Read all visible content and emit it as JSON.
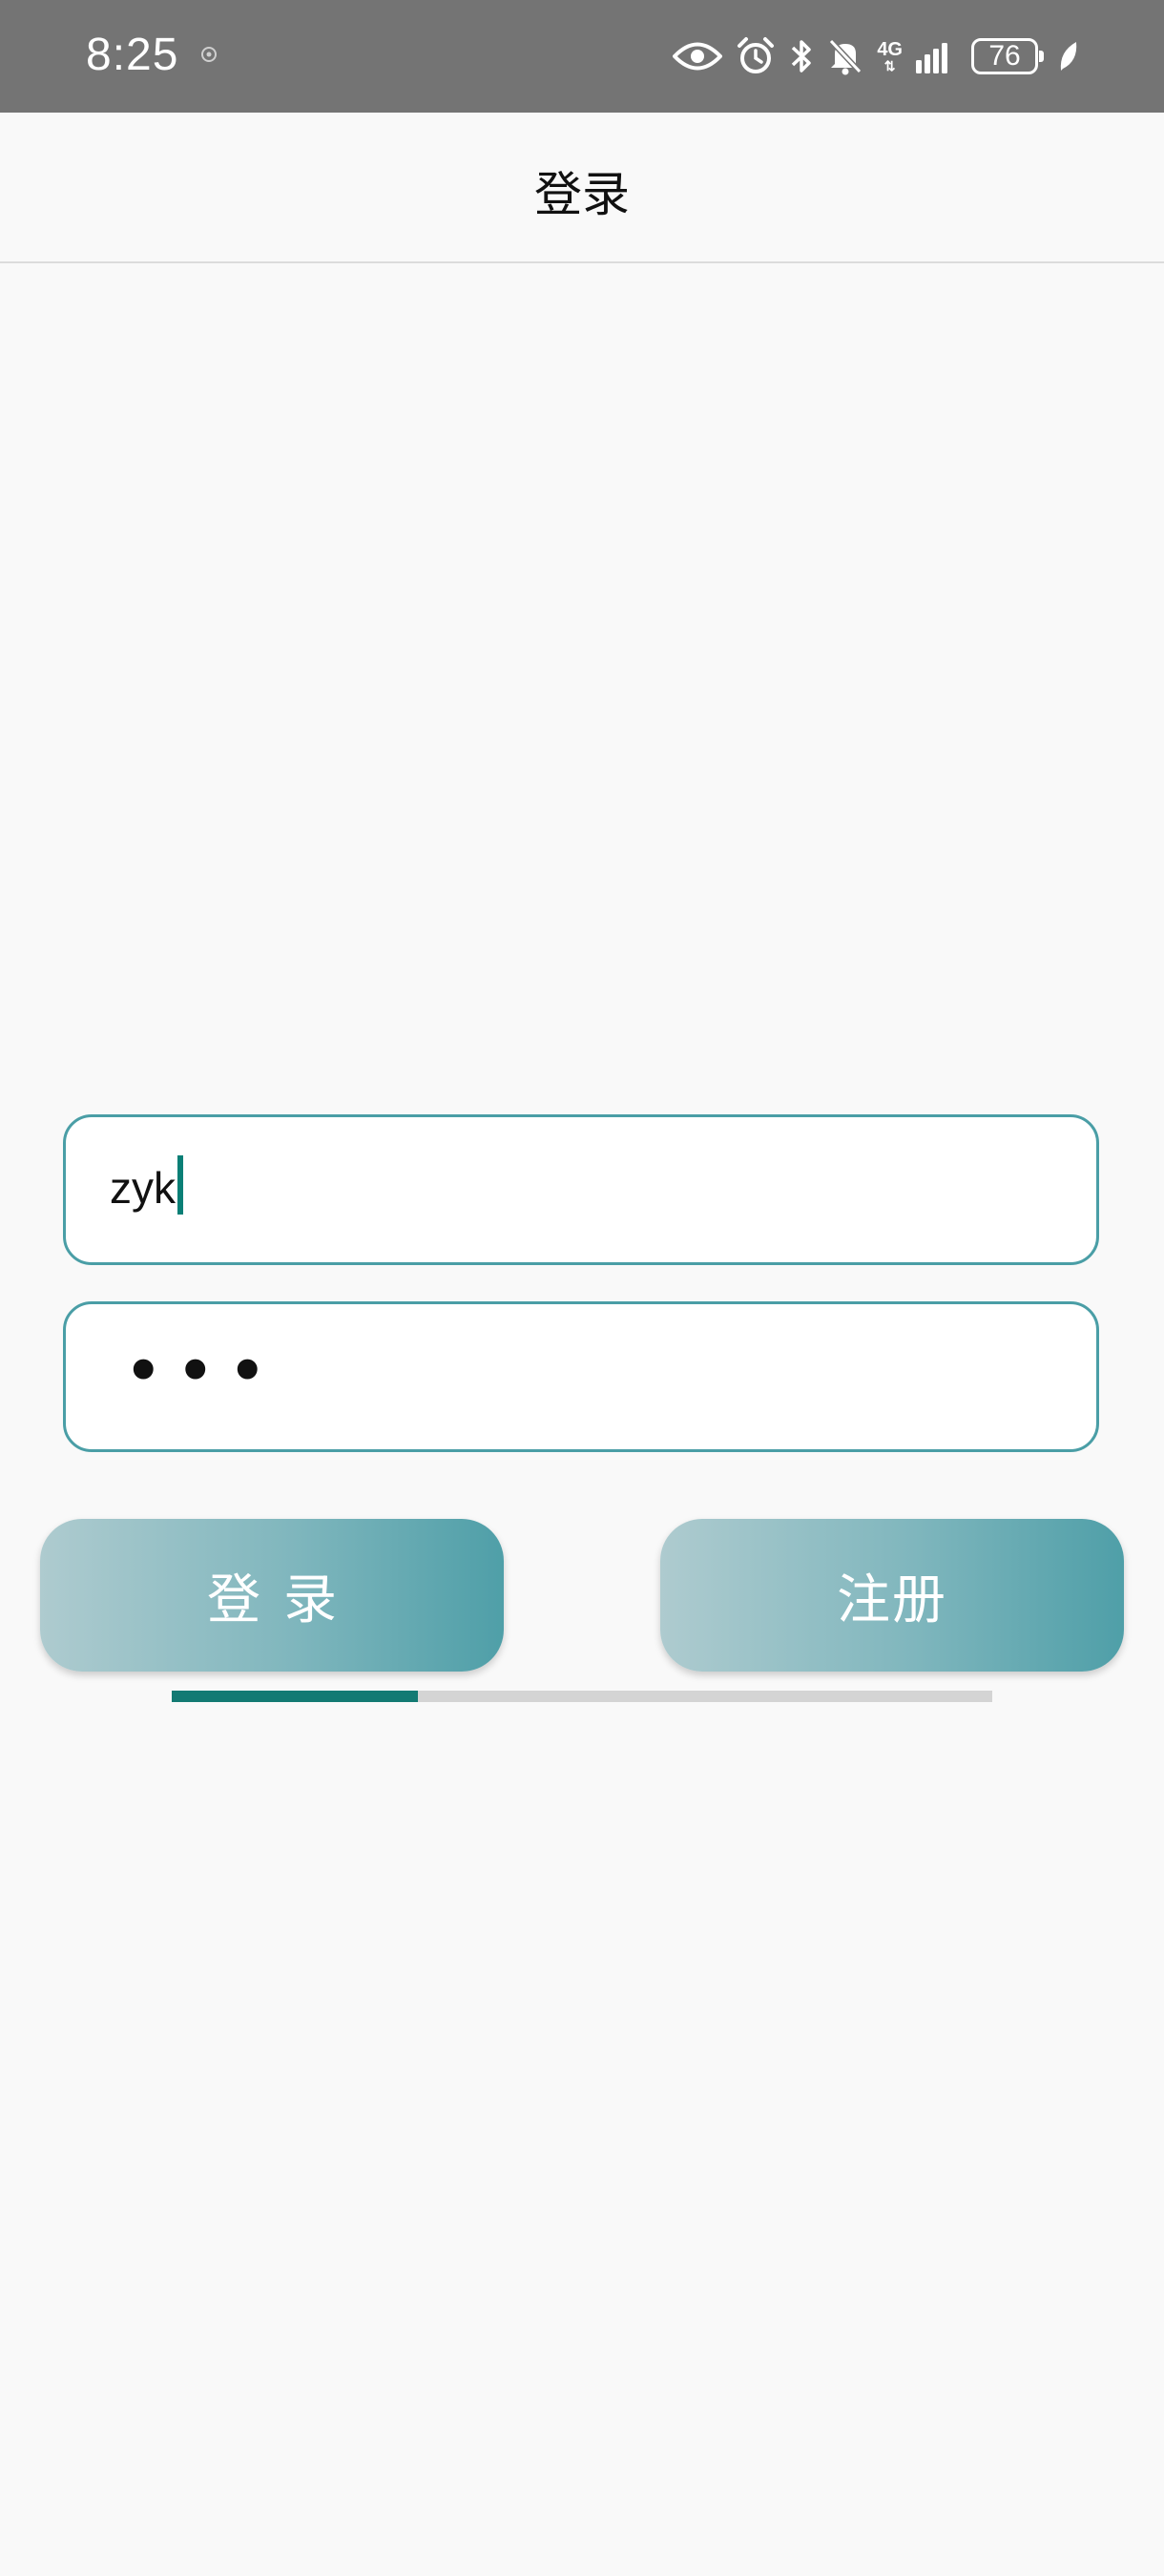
{
  "status_bar": {
    "time": "8:25",
    "network": "4G",
    "battery": "76",
    "icons": [
      "eye-icon",
      "alarm-icon",
      "bluetooth-icon",
      "mute-icon",
      "signal-icon",
      "battery-icon",
      "leaf-icon"
    ]
  },
  "app_bar": {
    "title": "登录"
  },
  "form": {
    "username_value": "zyk",
    "password_dots": "•••"
  },
  "buttons": {
    "login_label": "登录",
    "register_label": "注册"
  },
  "progress": {
    "fraction": 0.3
  },
  "colors": {
    "accent": "#137a73",
    "field_border": "#4a9ea6",
    "button_gradient_start": "#aecbcf",
    "button_gradient_end": "#4f9fa8",
    "status_bar": "#747474"
  }
}
